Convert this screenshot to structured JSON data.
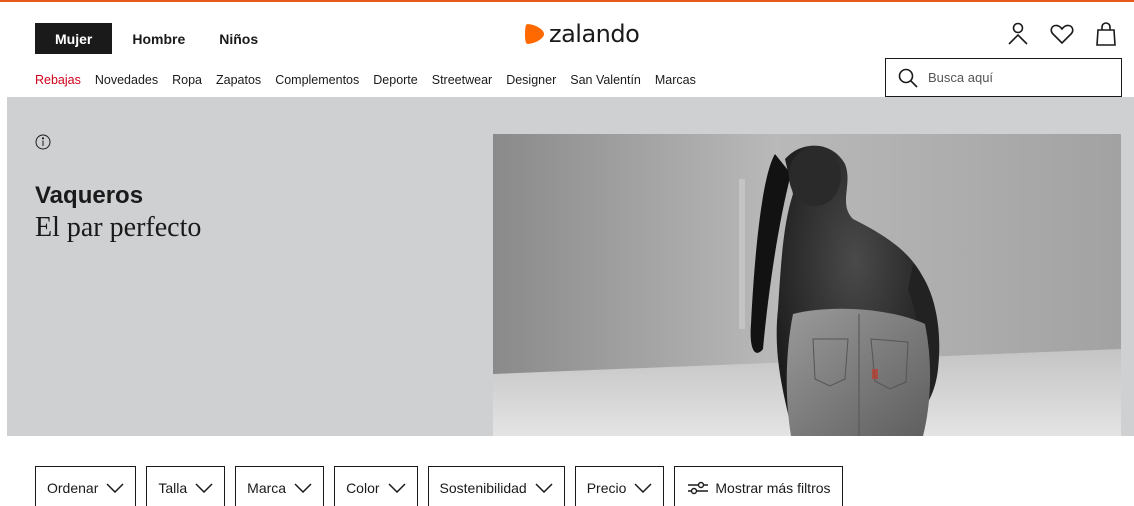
{
  "header": {
    "gender_tabs": [
      {
        "label": "Mujer",
        "active": true
      },
      {
        "label": "Hombre",
        "active": false
      },
      {
        "label": "Niños",
        "active": false
      }
    ],
    "logo_text": "zalando",
    "accent_color": "#ff6900",
    "icons": [
      "account-icon",
      "wishlist-heart-icon",
      "shopping-bag-icon"
    ]
  },
  "nav": {
    "categories": [
      "Rebajas",
      "Novedades",
      "Ropa",
      "Zapatos",
      "Complementos",
      "Deporte",
      "Streetwear",
      "Designer",
      "San Valentín",
      "Marcas"
    ],
    "sale_color": "#d0021b"
  },
  "search": {
    "placeholder": "Busca aquí"
  },
  "hero": {
    "title": "Vaqueros",
    "subtitle": "El par perfecto",
    "background": "#cfd0d2"
  },
  "filters": {
    "items": [
      "Ordenar",
      "Talla",
      "Marca",
      "Color",
      "Sostenibilidad",
      "Precio"
    ],
    "more_label": "Mostrar más filtros"
  }
}
